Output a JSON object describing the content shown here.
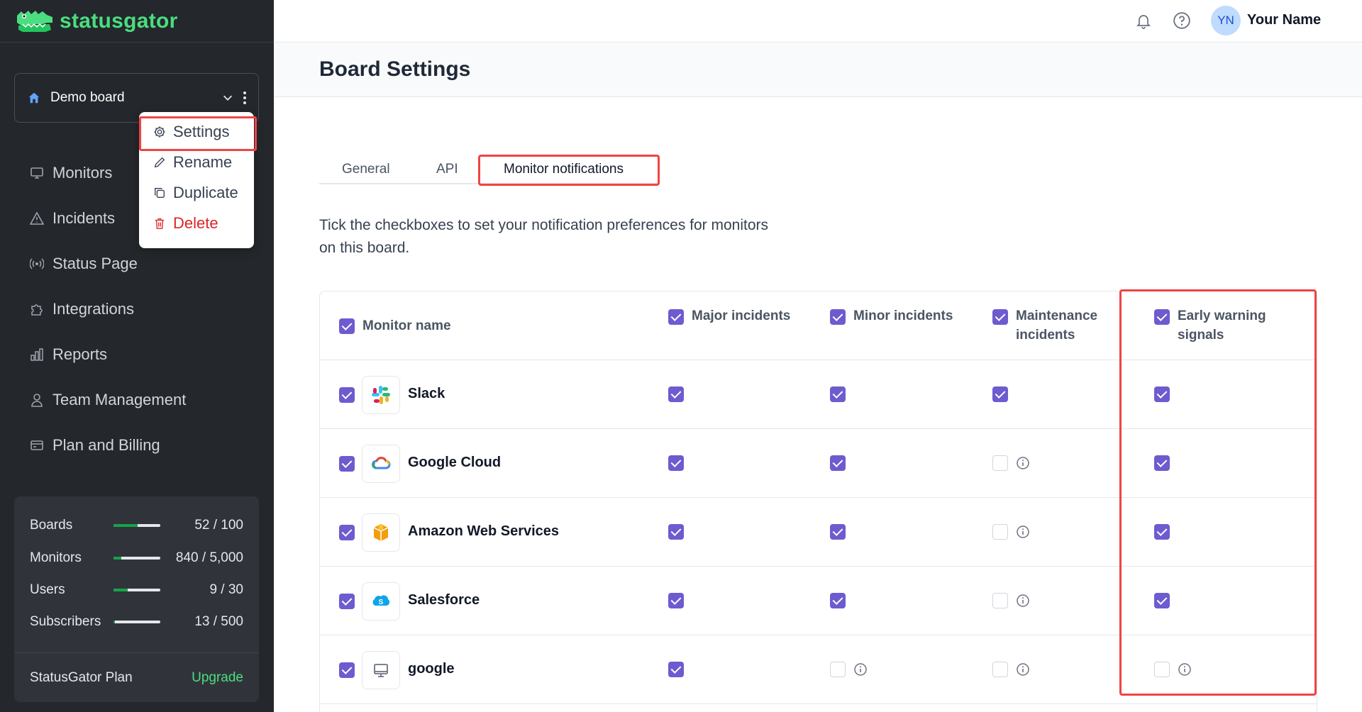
{
  "app": {
    "logo_text": "statusgator"
  },
  "sidebar": {
    "board_name": "Demo board",
    "nav": [
      {
        "label": "Monitors",
        "icon": "monitor-icon"
      },
      {
        "label": "Incidents",
        "icon": "warning-icon"
      },
      {
        "label": "Status Page",
        "icon": "broadcast-icon"
      },
      {
        "label": "Integrations",
        "icon": "puzzle-icon"
      },
      {
        "label": "Reports",
        "icon": "bar-chart-icon"
      },
      {
        "label": "Team Management",
        "icon": "user-icon"
      },
      {
        "label": "Plan and Billing",
        "icon": "credit-card-icon"
      }
    ],
    "usage": [
      {
        "label": "Boards",
        "value": "52 / 100",
        "fraction": 0.52
      },
      {
        "label": "Monitors",
        "value": "840 / 5,000",
        "fraction": 0.168
      },
      {
        "label": "Users",
        "value": "9 / 30",
        "fraction": 0.3
      },
      {
        "label": "Subscribers",
        "value": "13 / 500",
        "fraction": 0.026
      }
    ],
    "plan_name": "StatusGator Plan",
    "upgrade_label": "Upgrade"
  },
  "board_menu": {
    "items": [
      {
        "label": "Settings",
        "icon": "gear-icon"
      },
      {
        "label": "Rename",
        "icon": "pencil-icon"
      },
      {
        "label": "Duplicate",
        "icon": "copy-icon"
      },
      {
        "label": "Delete",
        "icon": "trash-icon"
      }
    ]
  },
  "topbar": {
    "avatar_initials": "YN",
    "user_name": "Your Name"
  },
  "page": {
    "title": "Board Settings",
    "tabs": [
      "General",
      "API",
      "Monitor notifications"
    ],
    "active_tab": "Monitor notifications",
    "intro": "Tick the checkboxes to set your notification preferences for monitors on this board."
  },
  "table": {
    "columns": [
      "Monitor name",
      "Major incidents",
      "Minor incidents",
      "Maintenance incidents",
      "Early warning signals"
    ],
    "rows": [
      {
        "name": "Slack",
        "logo": "slack-logo",
        "selected": true,
        "major": true,
        "minor": true,
        "maintenance": true,
        "early": true
      },
      {
        "name": "Google Cloud",
        "logo": "google-cloud-logo",
        "selected": true,
        "major": true,
        "minor": true,
        "maintenance": false,
        "early": true
      },
      {
        "name": "Amazon Web Services",
        "logo": "aws-logo",
        "selected": true,
        "major": true,
        "minor": true,
        "maintenance": false,
        "early": true
      },
      {
        "name": "Salesforce",
        "logo": "salesforce-logo",
        "selected": true,
        "major": true,
        "minor": true,
        "maintenance": false,
        "early": true
      },
      {
        "name": "google",
        "logo": "monitor-icon",
        "selected": true,
        "major": true,
        "minor": false,
        "maintenance": false,
        "early": false
      }
    ]
  },
  "colors": {
    "sidebar_bg": "#24272b",
    "accent_green": "#4ade80",
    "checkbox_purple": "#6d5bd0",
    "highlight_red": "#ef4444",
    "danger": "#dc2626"
  }
}
